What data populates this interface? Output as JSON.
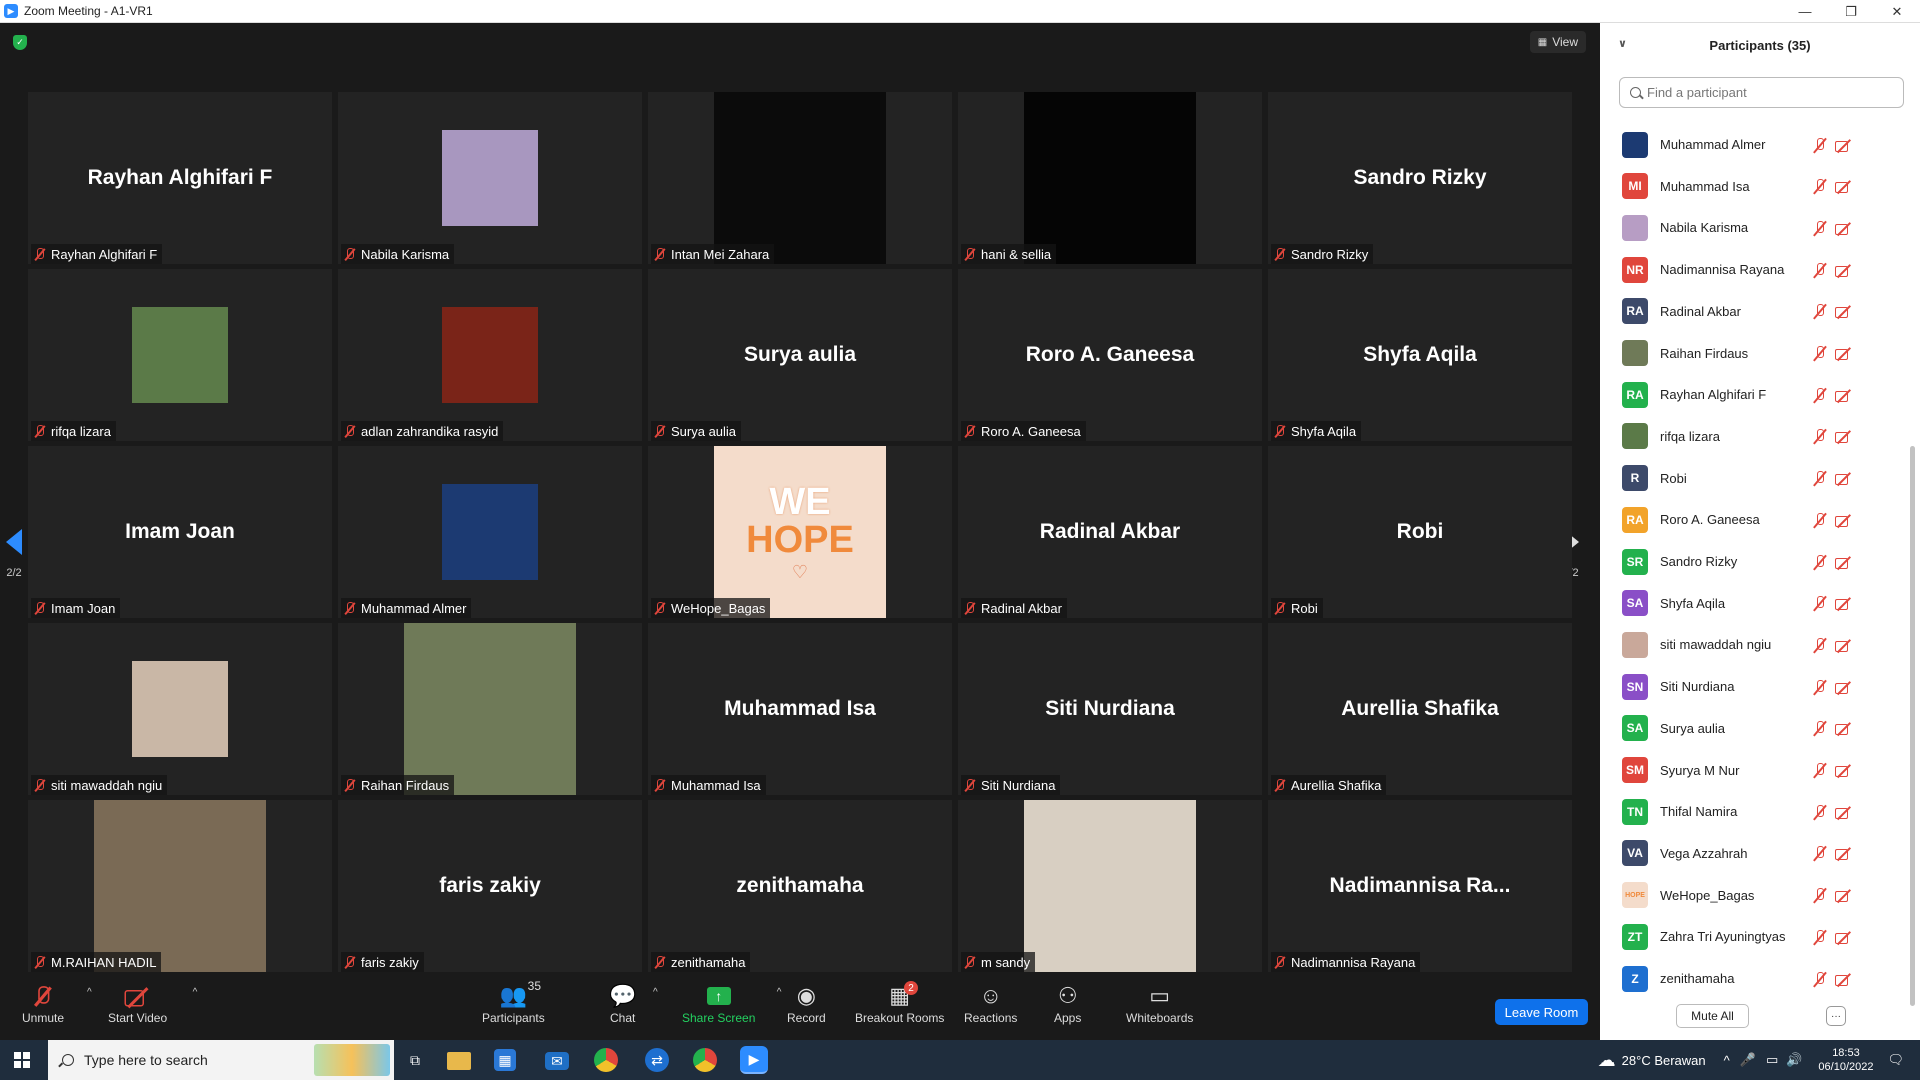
{
  "window": {
    "title": "Zoom Meeting - A1-VR1",
    "controls": [
      "minimize",
      "restore",
      "close"
    ]
  },
  "meeting": {
    "view_label": "View",
    "page_indicator": "2/2",
    "tiles": [
      {
        "name": "Rayhan Alghifari F",
        "display": "Rayhan Alghifari F",
        "kind": "name"
      },
      {
        "name": "Nabila Karisma",
        "kind": "thumb",
        "color": "#a897bf"
      },
      {
        "name": "Intan Mei Zahara",
        "kind": "photo",
        "color": "#0b0b0b"
      },
      {
        "name": "hani & sellia",
        "kind": "photo",
        "color": "#050505"
      },
      {
        "name": "Sandro Rizky",
        "display": "Sandro Rizky",
        "kind": "name"
      },
      {
        "name": "rifqa lizara",
        "kind": "thumb",
        "color": "#5b7a48"
      },
      {
        "name": "adlan zahrandika rasyid",
        "kind": "thumb",
        "color": "#7a2418"
      },
      {
        "name": "Surya aulia",
        "display": "Surya aulia",
        "kind": "name"
      },
      {
        "name": "Roro A. Ganeesa",
        "display": "Roro A. Ganeesa",
        "kind": "name"
      },
      {
        "name": "Shyfa Aqila",
        "display": "Shyfa Aqila",
        "kind": "name"
      },
      {
        "name": "Imam Joan",
        "display": "Imam Joan",
        "kind": "name"
      },
      {
        "name": "Muhammad Almer",
        "kind": "thumb",
        "color": "#1c3a72"
      },
      {
        "name": "WeHope_Bagas",
        "kind": "logo",
        "color": "#f4dccb",
        "logo_line1": "WE",
        "logo_line2": "HOPE"
      },
      {
        "name": "Radinal Akbar",
        "display": "Radinal Akbar",
        "kind": "name"
      },
      {
        "name": "Robi",
        "display": "Robi",
        "kind": "name"
      },
      {
        "name": "siti mawaddah ngiu",
        "kind": "thumb",
        "color": "#c9b7a6"
      },
      {
        "name": "Raihan Firdaus",
        "kind": "photo",
        "color": "#6f7a58"
      },
      {
        "name": "Muhammad Isa",
        "display": "Muhammad Isa",
        "kind": "name"
      },
      {
        "name": "Siti Nurdiana",
        "display": "Siti Nurdiana",
        "kind": "name"
      },
      {
        "name": "Aurellia Shafika",
        "display": "Aurellia Shafika",
        "kind": "name"
      },
      {
        "name": "M.RAIHAN HADIL",
        "kind": "photo",
        "color": "#7a6a55"
      },
      {
        "name": "faris zakiy",
        "display": "faris zakiy",
        "kind": "name"
      },
      {
        "name": "zenithamaha",
        "display": "zenithamaha",
        "kind": "name"
      },
      {
        "name": "m sandy",
        "kind": "photo",
        "color": "#d8cfc2"
      },
      {
        "name": "Nadimannisa Rayana",
        "display": "Nadimannisa  Ra...",
        "kind": "name"
      }
    ]
  },
  "toolbar": {
    "unmute": "Unmute",
    "start_video": "Start Video",
    "participants": "Participants",
    "participants_count": "35",
    "chat": "Chat",
    "share_screen": "Share Screen",
    "record": "Record",
    "breakout_rooms": "Breakout Rooms",
    "breakout_badge": "2",
    "reactions": "Reactions",
    "apps": "Apps",
    "whiteboards": "Whiteboards",
    "leave_room": "Leave Room"
  },
  "panel": {
    "title": "Participants (35)",
    "search_placeholder": "Find a participant",
    "mute_all": "Mute All",
    "more": "···",
    "participants": [
      {
        "name": "Muhammad Almer",
        "initials": "",
        "color": "#1c3a72"
      },
      {
        "name": "Muhammad Isa",
        "initials": "MI",
        "color": "#e0463c"
      },
      {
        "name": "Nabila Karisma",
        "initials": "",
        "color": "#b79dc4"
      },
      {
        "name": "Nadimannisa Rayana",
        "initials": "NR",
        "color": "#e0463c"
      },
      {
        "name": "Radinal Akbar",
        "initials": "RA",
        "color": "#3d4a6a"
      },
      {
        "name": "Raihan Firdaus",
        "initials": "",
        "color": "#6f7a58"
      },
      {
        "name": "Rayhan Alghifari F",
        "initials": "RA",
        "color": "#23b14d"
      },
      {
        "name": "rifqa lizara",
        "initials": "",
        "color": "#5b7a48"
      },
      {
        "name": "Robi",
        "initials": "R",
        "color": "#3d4a6a"
      },
      {
        "name": "Roro A. Ganeesa",
        "initials": "RA",
        "color": "#f2a32a"
      },
      {
        "name": "Sandro Rizky",
        "initials": "SR",
        "color": "#23b14d"
      },
      {
        "name": "Shyfa Aqila",
        "initials": "SA",
        "color": "#8a4fc7"
      },
      {
        "name": "siti mawaddah ngiu",
        "initials": "",
        "color": "#c9a89a"
      },
      {
        "name": "Siti Nurdiana",
        "initials": "SN",
        "color": "#8a4fc7"
      },
      {
        "name": "Surya aulia",
        "initials": "SA",
        "color": "#23b14d"
      },
      {
        "name": "Syurya M Nur",
        "initials": "SM",
        "color": "#e0463c"
      },
      {
        "name": "Thifal Namira",
        "initials": "TN",
        "color": "#23b14d"
      },
      {
        "name": "Vega Azzahrah",
        "initials": "VA",
        "color": "#3d4a6a"
      },
      {
        "name": "WeHope_Bagas",
        "initials": "HOPE",
        "color": "#f4dccb"
      },
      {
        "name": "Zahra Tri Ayuningtyas",
        "initials": "ZT",
        "color": "#23b14d"
      },
      {
        "name": "zenithamaha",
        "initials": "Z",
        "color": "#1e6fd0"
      }
    ]
  },
  "taskbar": {
    "search_placeholder": "Type here to search",
    "weather": "28°C  Berawan",
    "time": "18:53",
    "date": "06/10/2022"
  }
}
